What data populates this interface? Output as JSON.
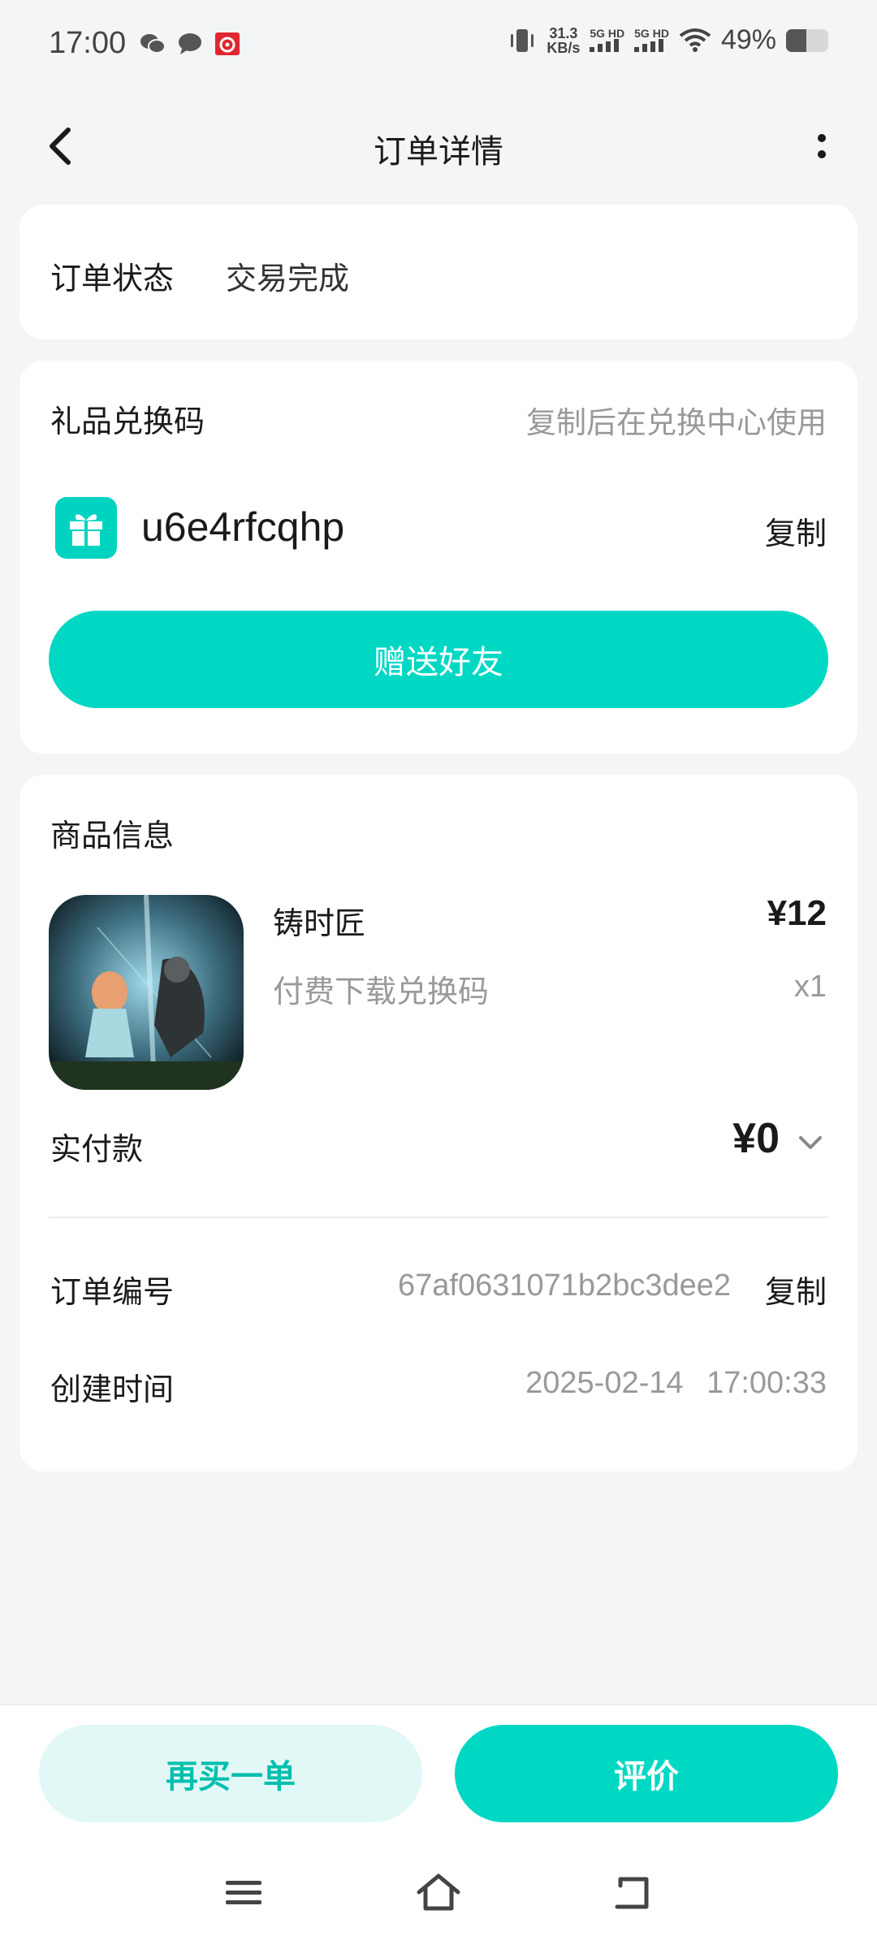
{
  "status_bar": {
    "time": "17:00",
    "speed_value": "31.3",
    "speed_unit": "KB/s",
    "net1": "5G HD",
    "net2": "5G HD",
    "battery_pct": "49%",
    "battery_level": 0.49
  },
  "nav": {
    "title": "订单详情"
  },
  "order_status": {
    "label": "订单状态",
    "value": "交易完成"
  },
  "gift": {
    "title": "礼品兑换码",
    "hint": "复制后在兑换中心使用",
    "code": "u6e4rfcqhp",
    "copy_label": "复制",
    "send_button": "赠送好友"
  },
  "product_info": {
    "title": "商品信息",
    "name": "铸时匠",
    "price": "¥12",
    "desc": "付费下载兑换码",
    "qty": "x1",
    "paid_label": "实付款",
    "paid_amount": "¥0",
    "order_no_label": "订单编号",
    "order_no": "67af0631071b2bc3dee2",
    "order_no_copy": "复制",
    "created_label": "创建时间",
    "created_time": "2025-02-14 17:00:33"
  },
  "bottom": {
    "rebuy_label": "再买一单",
    "review_label": "评价"
  },
  "colors": {
    "accent": "#00d8c4",
    "accent_light": "#e2f8f6",
    "background": "#f4f5f7"
  }
}
